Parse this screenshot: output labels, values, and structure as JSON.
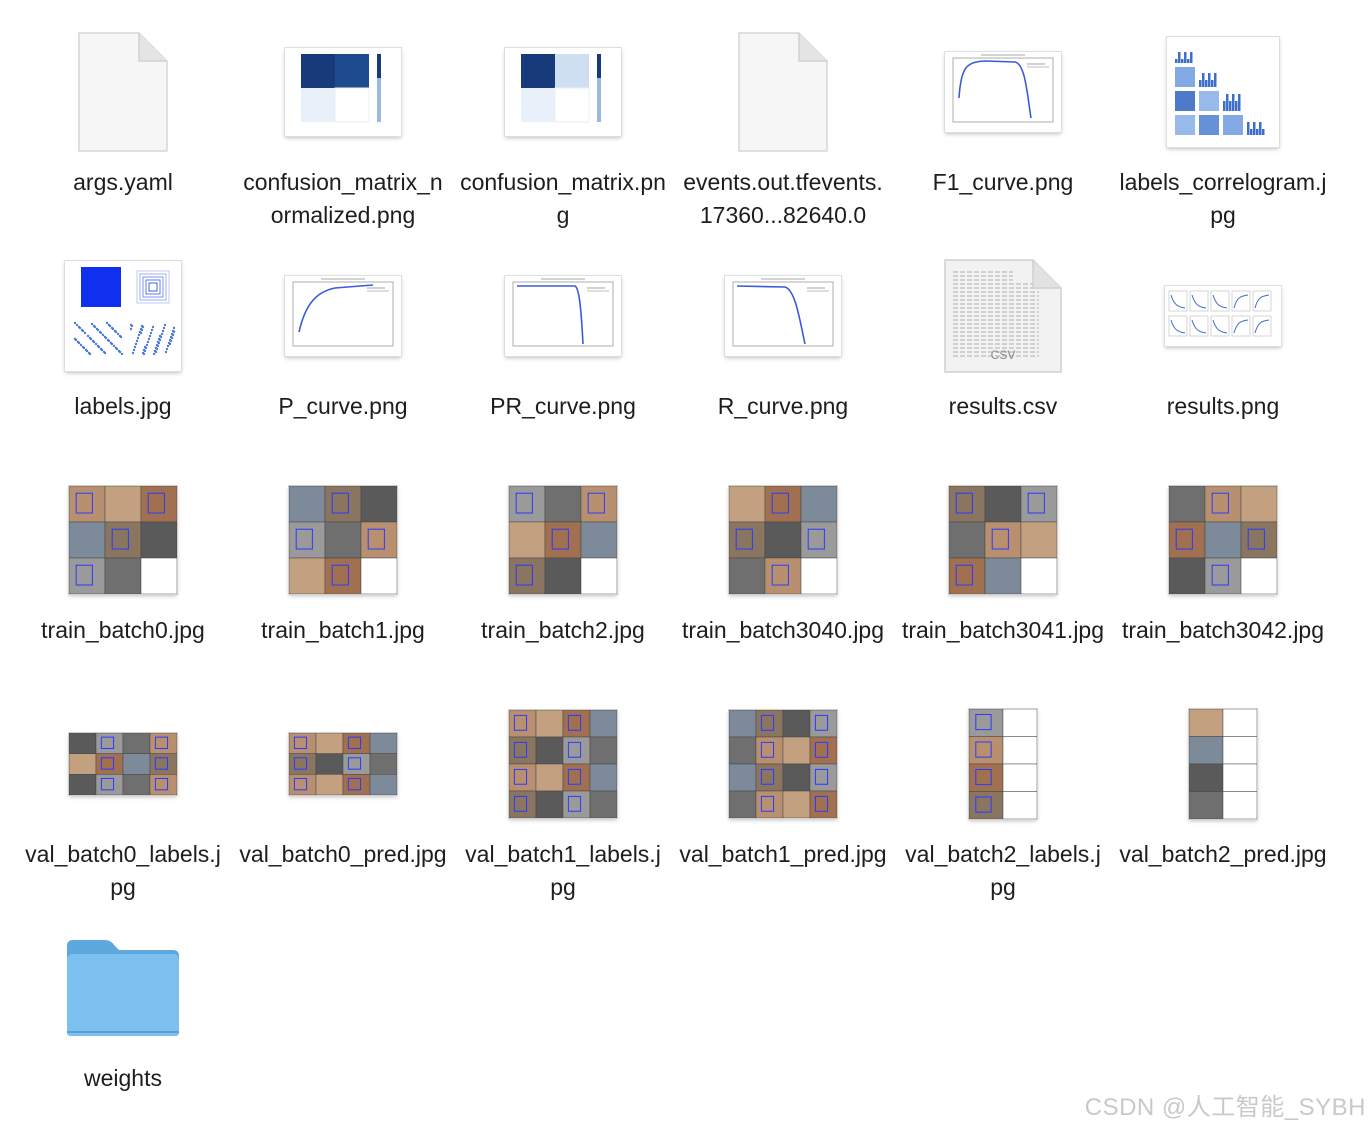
{
  "files": [
    {
      "name": "args.yaml",
      "kind": "blank-doc"
    },
    {
      "name": "confusion_matrix_normalized.png",
      "kind": "confusion-norm"
    },
    {
      "name": "confusion_matrix.png",
      "kind": "confusion"
    },
    {
      "name": "events.out.tfevents.17360...82640.0",
      "kind": "blank-doc"
    },
    {
      "name": "F1_curve.png",
      "kind": "curve-f1"
    },
    {
      "name": "labels_correlogram.jpg",
      "kind": "correlogram"
    },
    {
      "name": "labels.jpg",
      "kind": "labels"
    },
    {
      "name": "P_curve.png",
      "kind": "curve-p"
    },
    {
      "name": "PR_curve.png",
      "kind": "curve-pr"
    },
    {
      "name": "R_curve.png",
      "kind": "curve-r"
    },
    {
      "name": "results.csv",
      "kind": "csv",
      "badge": "CSV"
    },
    {
      "name": "results.png",
      "kind": "results"
    },
    {
      "name": "train_batch0.jpg",
      "kind": "mosaic"
    },
    {
      "name": "train_batch1.jpg",
      "kind": "mosaic"
    },
    {
      "name": "train_batch2.jpg",
      "kind": "mosaic"
    },
    {
      "name": "train_batch3040.jpg",
      "kind": "mosaic"
    },
    {
      "name": "train_batch3041.jpg",
      "kind": "mosaic"
    },
    {
      "name": "train_batch3042.jpg",
      "kind": "mosaic"
    },
    {
      "name": "val_batch0_labels.jpg",
      "kind": "val-wide"
    },
    {
      "name": "val_batch0_pred.jpg",
      "kind": "val-wide"
    },
    {
      "name": "val_batch1_labels.jpg",
      "kind": "val-square"
    },
    {
      "name": "val_batch1_pred.jpg",
      "kind": "val-square"
    },
    {
      "name": "val_batch2_labels.jpg",
      "kind": "val-tall"
    },
    {
      "name": "val_batch2_pred.jpg",
      "kind": "val-tall"
    },
    {
      "name": "weights",
      "kind": "folder"
    }
  ],
  "watermark": "CSDN @人工智能_SYBH",
  "colors": {
    "folder": "#7cc0f0",
    "folder_tab": "#5ea8e0",
    "confusion_dark": "#173a7a",
    "confusion_light": "#e8f0fa",
    "curve_line": "#3a5bd9",
    "photo_tones": [
      "#8a7560",
      "#6f6f6f",
      "#a07050",
      "#5a5a5a",
      "#b89070",
      "#7d8a99",
      "#9a9a9a",
      "#c2a080"
    ]
  }
}
